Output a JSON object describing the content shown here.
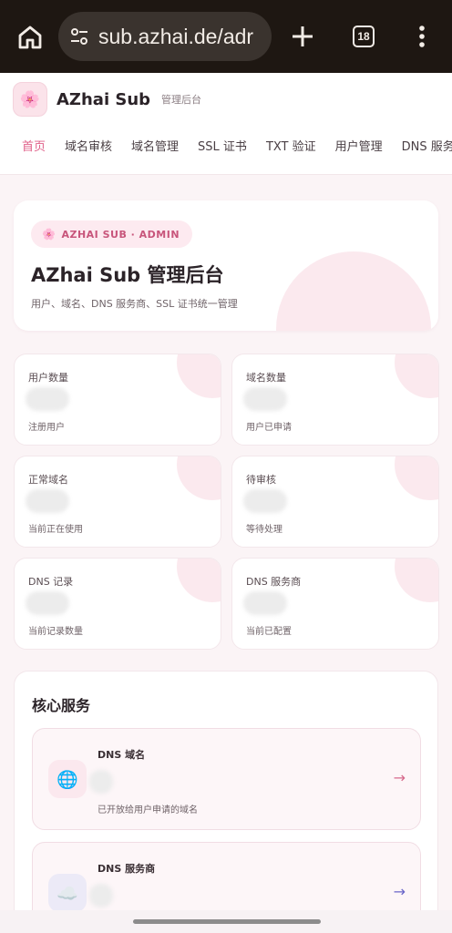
{
  "browser": {
    "url": "sub.azhai.de/adr",
    "tab_count": "18",
    "icons": [
      "home-icon",
      "site-settings-icon",
      "new-tab-icon",
      "tab-switcher-icon",
      "more-menu-icon"
    ]
  },
  "header": {
    "logo_glyph": "🌸",
    "brand_name": "AZhai Sub",
    "brand_sub": "管理后台"
  },
  "nav": {
    "items": [
      "首页",
      "域名审核",
      "域名管理",
      "SSL 证书",
      "TXT 验证",
      "用户管理",
      "DNS 服务"
    ],
    "active_index": 0
  },
  "hero": {
    "chip_glyph": "🌸",
    "chip": "AZHAI SUB · ADMIN",
    "title": "AZhai Sub 管理后台",
    "description": "用户、域名、DNS 服务商、SSL 证书统一管理"
  },
  "stats": [
    {
      "label": "用户数量",
      "hint": "注册用户"
    },
    {
      "label": "域名数量",
      "hint": "用户已申请"
    },
    {
      "label": "正常域名",
      "hint": "当前正在使用"
    },
    {
      "label": "待审核",
      "hint": "等待处理"
    },
    {
      "label": "DNS 记录",
      "hint": "当前记录数量"
    },
    {
      "label": "DNS 服务商",
      "hint": "当前已配置"
    }
  ],
  "core": {
    "title": "核心服务",
    "services": [
      {
        "icon": "globe-icon",
        "glyph": "🌐",
        "name": "DNS 域名",
        "desc": "已开放给用户申请的域名",
        "arrow": "→"
      },
      {
        "icon": "cloud-icon",
        "glyph": "☁️",
        "name": "DNS 服务商",
        "desc": "",
        "arrow": "→"
      }
    ]
  },
  "colors": {
    "accent": "#e0628a",
    "background": "#fbf4f6",
    "browser_bar": "#1e1712"
  }
}
